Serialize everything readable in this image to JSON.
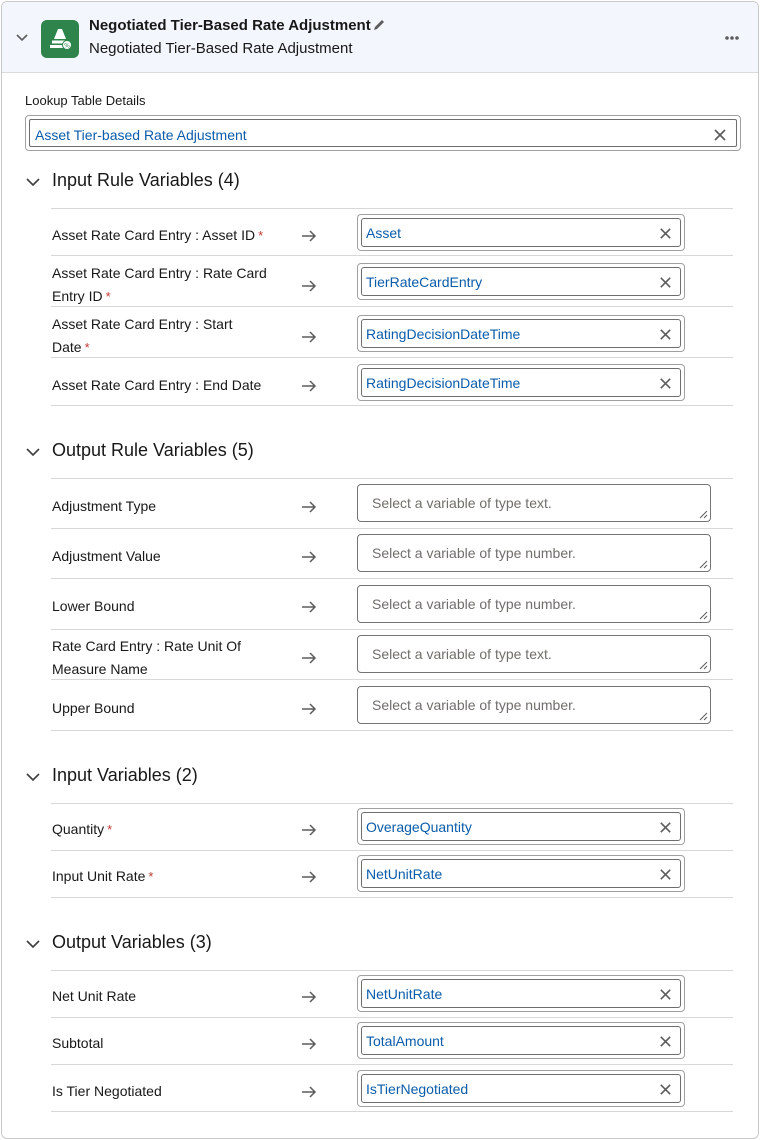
{
  "header": {
    "title": "Negotiated Tier-Based Rate Adjustment",
    "subtitle": "Negotiated Tier-Based Rate Adjustment",
    "icon": "tier-rate-icon",
    "icon_color": "#2e844a",
    "edit_icon": "pencil-icon",
    "more_icon": "more-actions-icon"
  },
  "lookup": {
    "label": "Lookup Table Details",
    "value": "Asset Tier-based Rate Adjustment"
  },
  "sections": {
    "input_rule": {
      "title": "Input Rule Variables (4)",
      "rows": [
        {
          "label_lines": [
            "Asset Rate Card Entry : Asset ID"
          ],
          "required": true,
          "value": "Asset"
        },
        {
          "label_lines": [
            "Asset Rate Card Entry : Rate Card",
            "Entry ID"
          ],
          "required": true,
          "value": "TierRateCardEntry"
        },
        {
          "label_lines": [
            "Asset Rate Card Entry : Start",
            "Date"
          ],
          "required": true,
          "value": "RatingDecisionDateTime"
        },
        {
          "label_lines": [
            "Asset Rate Card Entry : End Date"
          ],
          "required": false,
          "value": "RatingDecisionDateTime"
        }
      ]
    },
    "output_rule": {
      "title": "Output Rule Variables (5)",
      "rows": [
        {
          "label_lines": [
            "Adjustment Type"
          ],
          "placeholder": "Select a variable of type text."
        },
        {
          "label_lines": [
            "Adjustment Value"
          ],
          "placeholder": "Select a variable of type number."
        },
        {
          "label_lines": [
            "Lower Bound"
          ],
          "placeholder": "Select a variable of type number."
        },
        {
          "label_lines": [
            "Rate Card Entry : Rate Unit Of",
            "Measure Name"
          ],
          "placeholder": "Select a variable of type text."
        },
        {
          "label_lines": [
            "Upper Bound"
          ],
          "placeholder": "Select a variable of type number."
        }
      ]
    },
    "input_vars": {
      "title": "Input Variables (2)",
      "rows": [
        {
          "label_lines": [
            "Quantity"
          ],
          "required": true,
          "value": "OverageQuantity"
        },
        {
          "label_lines": [
            "Input Unit Rate"
          ],
          "required": true,
          "value": "NetUnitRate"
        }
      ]
    },
    "output_vars": {
      "title": "Output Variables (3)",
      "rows": [
        {
          "label_lines": [
            "Net Unit Rate"
          ],
          "required": false,
          "value": "NetUnitRate"
        },
        {
          "label_lines": [
            "Subtotal"
          ],
          "required": false,
          "value": "TotalAmount"
        },
        {
          "label_lines": [
            "Is Tier Negotiated"
          ],
          "required": false,
          "value": "IsTierNegotiated"
        }
      ]
    }
  },
  "required_marker": "*",
  "colors": {
    "link_blue": "#0b5cab",
    "required_red": "#c23934",
    "header_bg": "#f3f6fd"
  }
}
